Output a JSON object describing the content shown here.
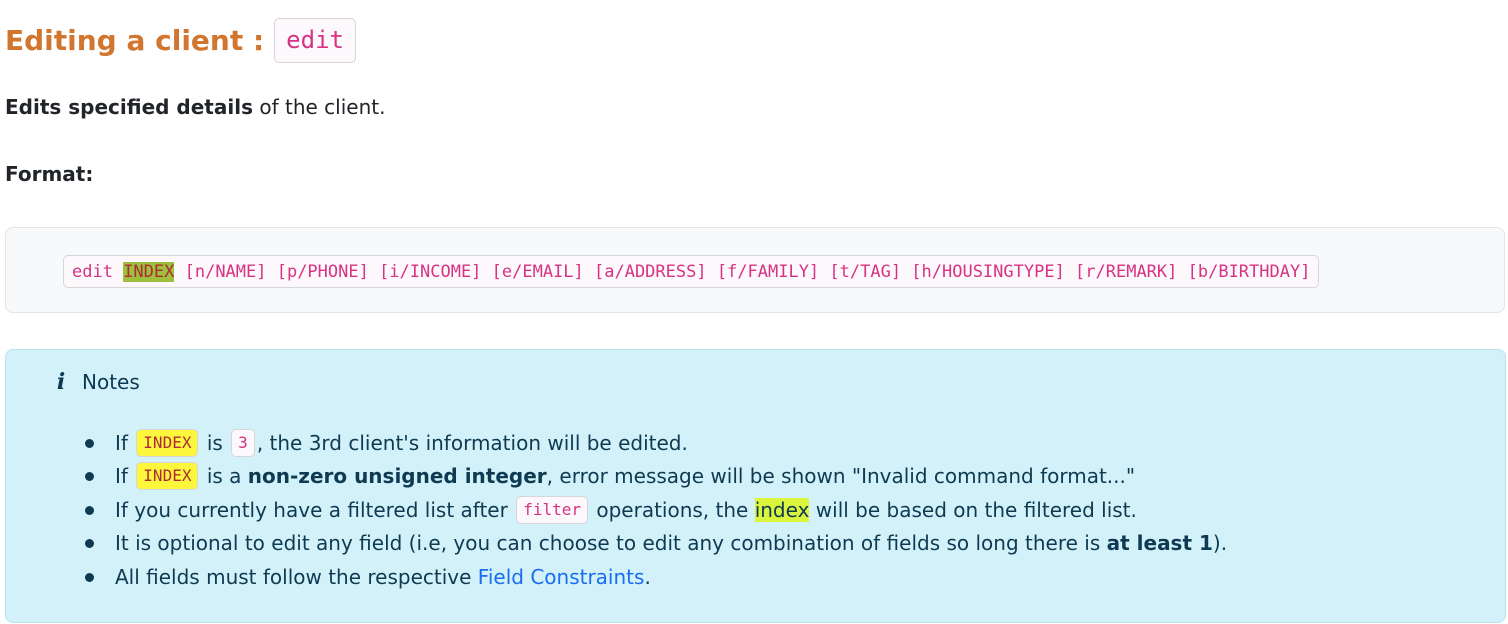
{
  "heading": {
    "text": "Editing a client :",
    "code": "edit"
  },
  "lead": {
    "bold": "Edits specified details",
    "rest": " of the client."
  },
  "format": {
    "label": "Format:",
    "cmd": "edit ",
    "index": "INDEX",
    "args": " [n/NAME] [p/PHONE] [i/INCOME] [e/EMAIL] [a/ADDRESS] [f/FAMILY] [t/TAG] [h/HOUSINGTYPE] [r/REMARK] [b/BIRTHDAY]"
  },
  "notes": {
    "icon": "info-icon",
    "title": "Notes",
    "items": [
      {
        "t1": "If ",
        "code1": "INDEX",
        "t2": " is ",
        "code2": "3",
        "t3": ", the 3rd client's information will be edited."
      },
      {
        "t1": "If ",
        "code1": "INDEX",
        "t2": " is a ",
        "bold": "non-zero unsigned integer",
        "t3": ", error message will be shown \"Invalid command format...\""
      },
      {
        "t1": "If you currently have a filtered list after ",
        "code1": "filter",
        "t2": " operations, the ",
        "hl": "index",
        "t3": " will be based on the filtered list."
      },
      {
        "t1": "It is optional to edit any field (i.e, you can choose to edit any combination of fields so long there is ",
        "bold": "at least 1",
        "t2": ")."
      },
      {
        "t1": "All fields must follow the respective ",
        "link": "Field Constraints",
        "t2": "."
      }
    ]
  },
  "colors": {
    "heading": "#d2762f",
    "code_text": "#d63384",
    "notes_bg": "#d3f1f9",
    "link": "#1a6df0",
    "highlight_yellow": "#fcf63d",
    "highlight_lime": "#dbf53c",
    "highlight_olive": "#9cbf3c"
  }
}
